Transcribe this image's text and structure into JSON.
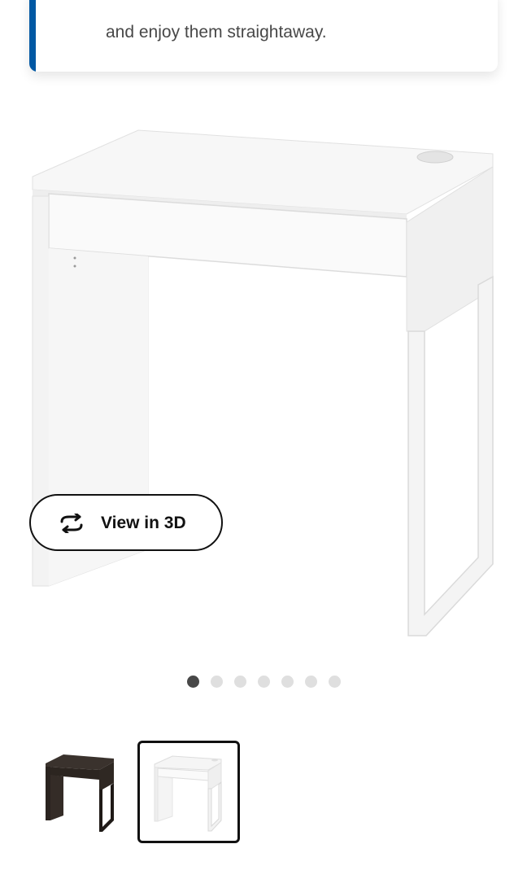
{
  "banner": {
    "text": "and enjoy them straightaway.",
    "accent_color": "#0058a3"
  },
  "product_image": {
    "icon": "white-desk-image"
  },
  "view_3d_button": {
    "label": "View in 3D",
    "icon": "rotate-3d-icon"
  },
  "carousel": {
    "total_dots": 7,
    "active_index": 0
  },
  "thumbnails": [
    {
      "variant": "black-brown",
      "selected": false
    },
    {
      "variant": "white",
      "selected": true
    }
  ]
}
